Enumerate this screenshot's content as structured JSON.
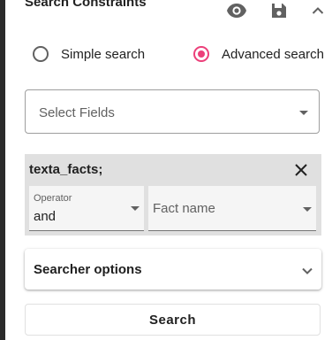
{
  "header": {
    "title": "Search Constraints",
    "icons": [
      "eye-icon",
      "save-icon",
      "chevron-up-icon"
    ]
  },
  "search_mode": {
    "options": [
      {
        "label": "Simple search",
        "selected": false
      },
      {
        "label": "Advanced search",
        "selected": true
      }
    ],
    "accent_color": "#ec407a"
  },
  "select_fields": {
    "placeholder": "Select Fields"
  },
  "facts_constraint": {
    "title": "texta_facts;",
    "operator": {
      "label": "Operator",
      "value": "and"
    },
    "fact_name": {
      "placeholder": "Fact name"
    }
  },
  "searcher_options": {
    "title": "Searcher options"
  },
  "search_button": {
    "label": "Search"
  }
}
